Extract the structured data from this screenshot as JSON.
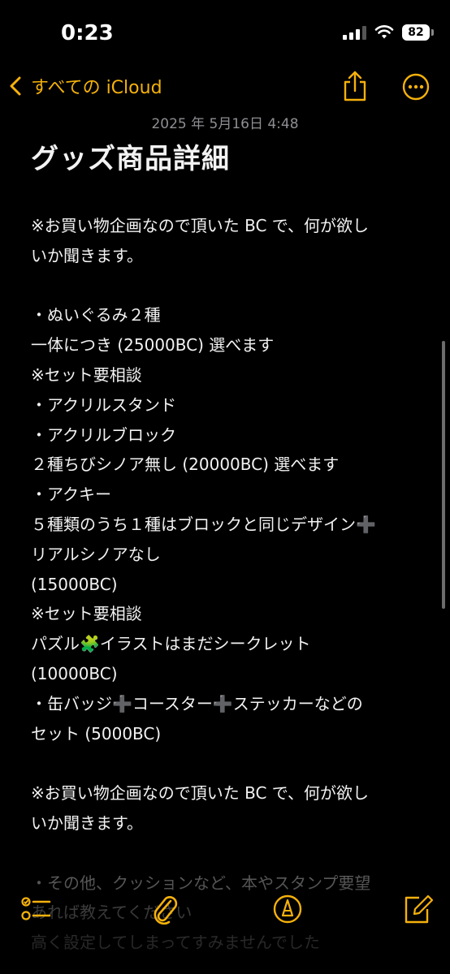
{
  "status_bar": {
    "time": "0:23",
    "battery": "82"
  },
  "nav": {
    "back_label": "すべての iCloud",
    "accent_color": "#f5b10c"
  },
  "note": {
    "date": "2025 年 5月16日 4:48",
    "title": "グッズ商品詳細",
    "lines": [
      "※お買い物企画なので頂いた BC で、何が欲し",
      "いか聞きます。",
      "",
      "・ぬいぐるみ２種",
      "一体につき (25000BC) 選べます",
      "※セット要相談",
      "・アクリルスタンド",
      "・アクリルブロック",
      "２種ちびシノア無し (20000BC) 選べます",
      "・アクキー",
      "５種類のうち１種はブロックと同じデザイン➕",
      "リアルシノアなし",
      "(15000BC)",
      "※セット要相談",
      "パズル🧩イラストはまだシークレット",
      "(10000BC)",
      "・缶バッジ➕コースター➕ステッカーなどの",
      "セット (5000BC)",
      "",
      "※お買い物企画なので頂いた BC で、何が欲し",
      "いか聞きます。",
      "",
      "・その他、クッションなど、本やスタンプ要望",
      "あれば教えてください",
      "高く設定してしまってすみませんでした"
    ]
  },
  "toolbar": {
    "icons": [
      "checklist-icon",
      "attachment-icon",
      "markup-icon",
      "compose-icon"
    ]
  }
}
